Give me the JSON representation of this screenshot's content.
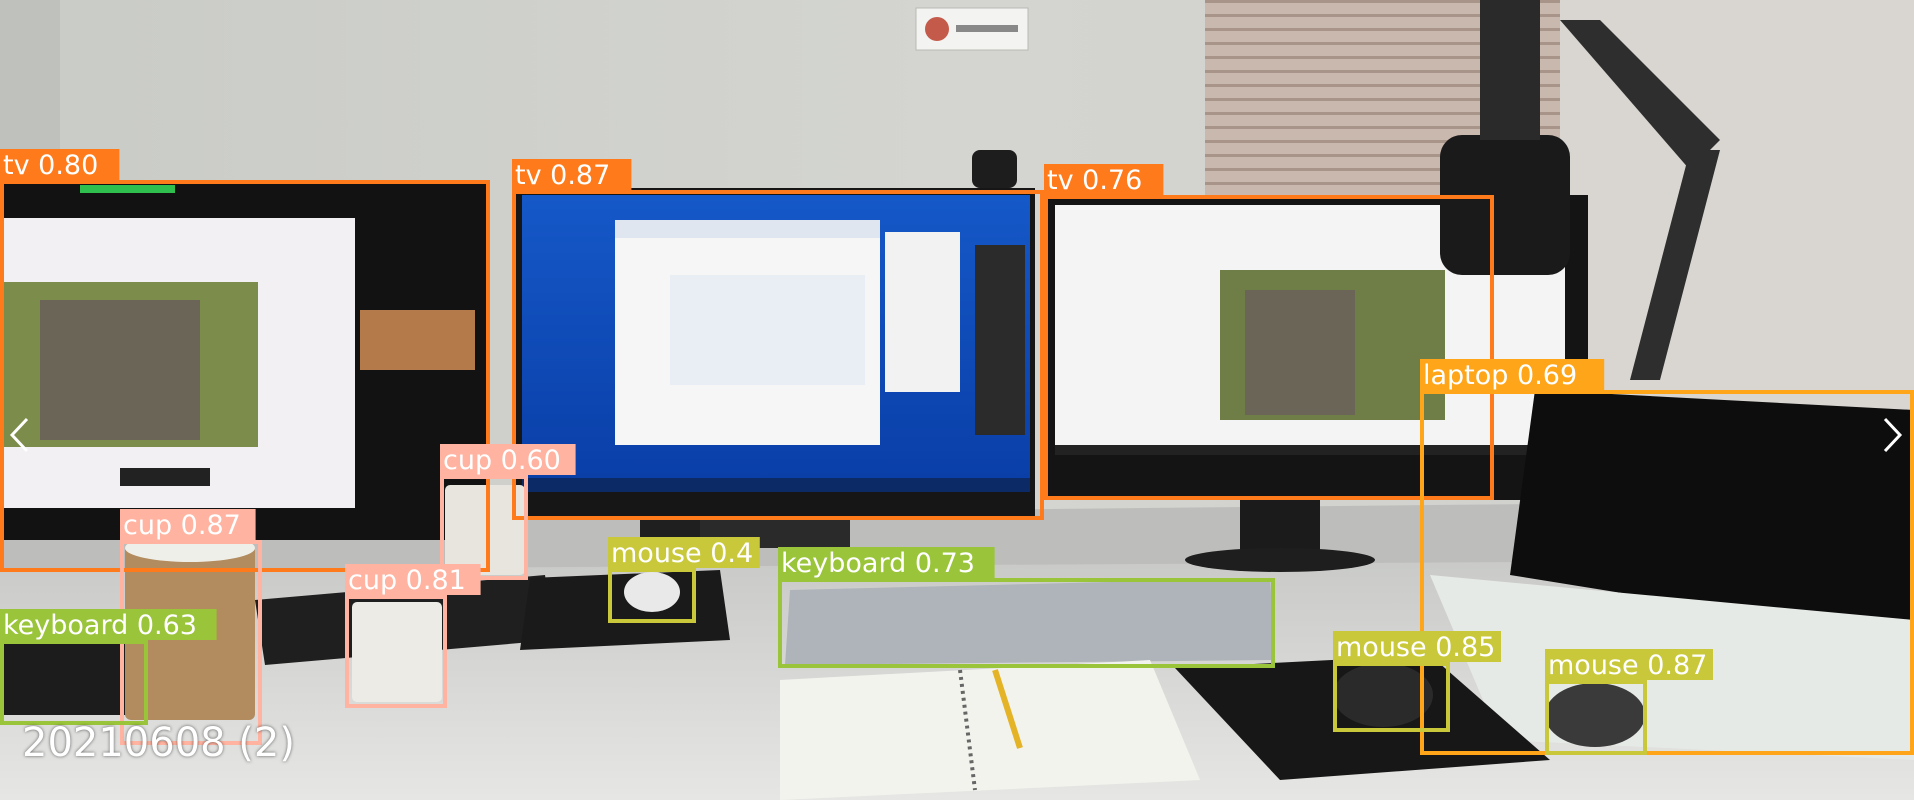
{
  "caption": "20210608 (2)",
  "wall_sign_icon": "face-badge-icon",
  "nav": {
    "prev_icon": "chevron-left-icon",
    "next_icon": "chevron-right-icon"
  },
  "class_colors": {
    "tv": "#ff7a1a",
    "cup": "#ffb3a0",
    "mouse": "#c8c83a",
    "keyboard": "#9ac43a",
    "laptop": "#ffa51a"
  },
  "detections": [
    {
      "id": "tv-left",
      "label": "tv 0.80",
      "cls": "tv"
    },
    {
      "id": "tv-center",
      "label": "tv 0.87",
      "cls": "tv"
    },
    {
      "id": "tv-right",
      "label": "tv 0.76",
      "cls": "tv"
    },
    {
      "id": "laptop",
      "label": "laptop 0.69",
      "cls": "laptop"
    },
    {
      "id": "cup-1",
      "label": "cup 0.60",
      "cls": "cup"
    },
    {
      "id": "cup-2",
      "label": "cup 0.87",
      "cls": "cup"
    },
    {
      "id": "cup-3",
      "label": "cup 0.81",
      "cls": "cup"
    },
    {
      "id": "keyboard-1",
      "label": "keyboard 0.63",
      "cls": "keyboard"
    },
    {
      "id": "keyboard-2",
      "label": "keyboard 0.73",
      "cls": "keyboard"
    },
    {
      "id": "mouse-1",
      "label": "mouse 0.4",
      "cls": "mouse"
    },
    {
      "id": "mouse-2",
      "label": "mouse 0.85",
      "cls": "mouse"
    },
    {
      "id": "mouse-3",
      "label": "mouse 0.87",
      "cls": "mouse"
    }
  ]
}
